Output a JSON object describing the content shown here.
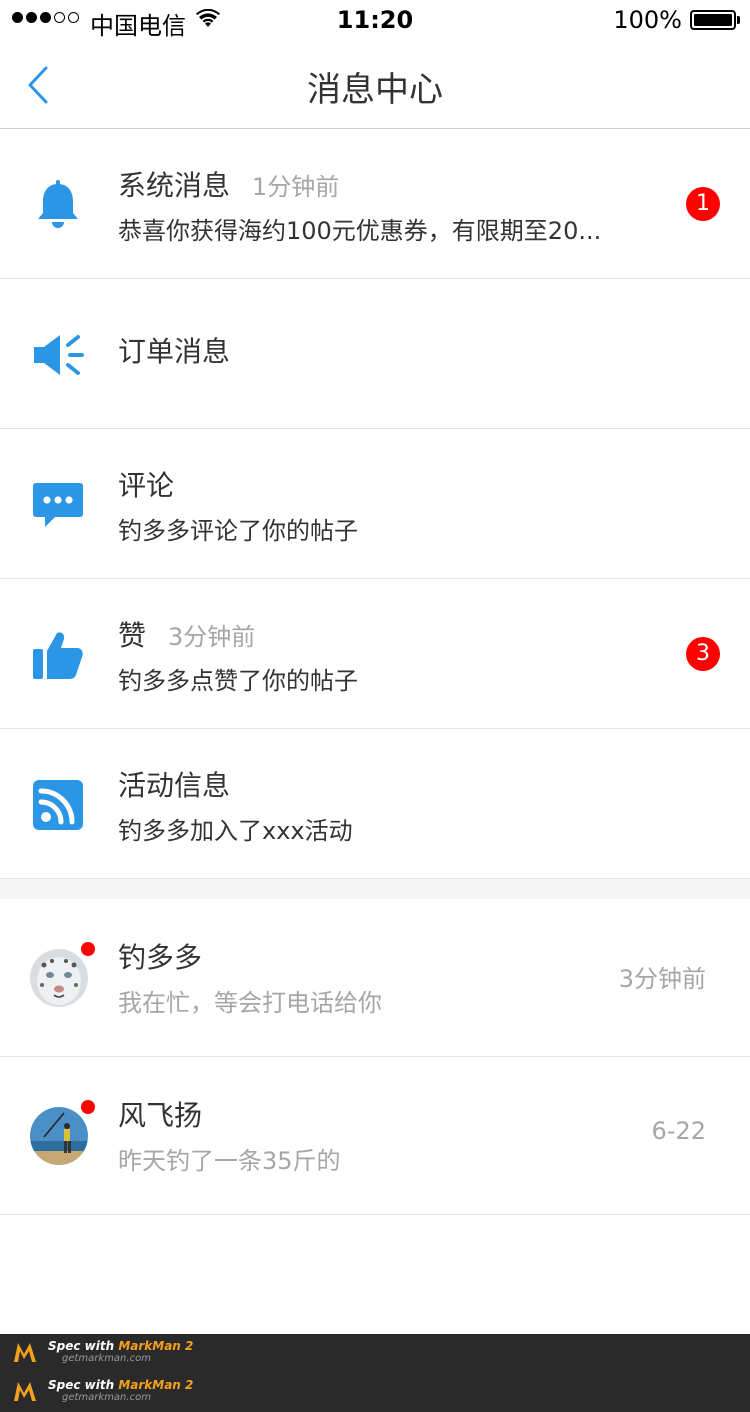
{
  "status_bar": {
    "carrier": "中国电信",
    "time": "11:20",
    "battery": "100%",
    "signal_dots_full": 3,
    "signal_dots_total": 5
  },
  "nav": {
    "title": "消息中心"
  },
  "colors": {
    "accent": "#2b96e6",
    "badge": "#fe0100",
    "text_primary": "#333333",
    "text_secondary": "#a6a6a6"
  },
  "messages": [
    {
      "icon": "bell-icon",
      "title": "系统消息",
      "time": "1分钟前",
      "preview": "恭喜你获得海约100元优惠券，有限期至20...",
      "badge": "1"
    },
    {
      "icon": "speaker-icon",
      "title": "订单消息"
    },
    {
      "icon": "chat-bubble-icon",
      "title": "评论",
      "preview": "钓多多评论了你的帖子"
    },
    {
      "icon": "thumbs-up-icon",
      "title": "赞",
      "time": "3分钟前",
      "preview": "钓多多点赞了你的帖子",
      "badge": "3"
    },
    {
      "icon": "rss-icon",
      "title": "活动信息",
      "preview": "钓多多加入了xxx活动"
    }
  ],
  "chats": [
    {
      "avatar": "snow-leopard-avatar",
      "name": "钓多多",
      "text": "我在忙，等会打电话给你",
      "time": "3分钟前",
      "unread": true
    },
    {
      "avatar": "fisherman-avatar",
      "name": "风飞扬",
      "text": "昨天钓了一条35斤的",
      "time": "6-22",
      "unread": true
    }
  ],
  "footer": {
    "watermark_prefix": "Spec with ",
    "watermark_brand": "MarkMan 2",
    "watermark_url": "getmarkman.com"
  }
}
